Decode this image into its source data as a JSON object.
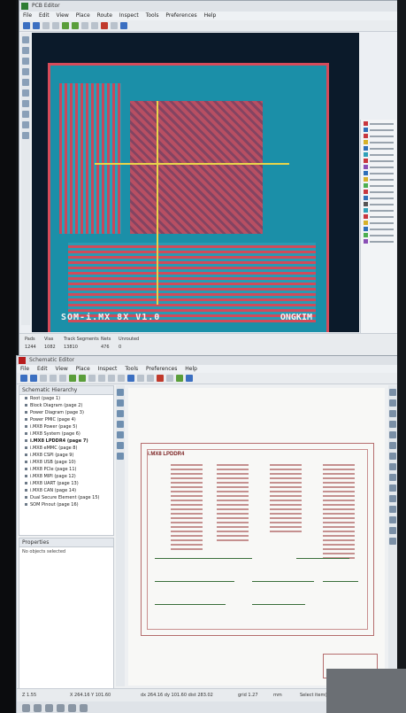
{
  "pcb": {
    "title": "PCB Editor",
    "menu": [
      "File",
      "Edit",
      "View",
      "Place",
      "Route",
      "Inspect",
      "Tools",
      "Preferences",
      "Help"
    ],
    "silkscreen_text": "SOM-i.MX 8X V1.0",
    "logo_text": "ONGKIM",
    "status": {
      "labels": [
        "Pads",
        "Vias",
        "Track Segments",
        "Nets",
        "Unrouted"
      ],
      "values": [
        "1244",
        "1082",
        "13810",
        "476",
        "0"
      ]
    }
  },
  "schematic": {
    "title": "Schematic Editor",
    "menu": [
      "File",
      "Edit",
      "View",
      "Place",
      "Inspect",
      "Tools",
      "Preferences",
      "Help"
    ],
    "hierarchy_title": "Schematic Hierarchy",
    "hierarchy": [
      "Root (page 1)",
      "Block Diagram (page 2)",
      "Power Diagram (page 3)",
      "Power PMIC (page 4)",
      "i.MX8 Power (page 5)",
      "i.MX8 System (page 6)",
      "i.MX8 LPDDR4 (page 7)",
      "i.MX8 eMMC (page 8)",
      "i.MX8 CSPI (page 9)",
      "i.MX8 USB (page 10)",
      "i.MX8 PCIe (page 11)",
      "i.MX8 MIPI (page 12)",
      "i.MX8 UART (page 13)",
      "i.MX8 CAN (page 14)",
      "Dual Secure Element (page 15)",
      "SOM Pinout (page 16)"
    ],
    "selected_index": 6,
    "properties_title": "Properties",
    "properties_text": "No objects selected",
    "sheet_title": "i.MX8 LPDDR4",
    "status": [
      "Z 1.55",
      "X 264.16 Y 101.60",
      "dx 264.16 dy 101.60 dist 283.02",
      "grid 1.27",
      "mm",
      "Select item(s)"
    ]
  }
}
